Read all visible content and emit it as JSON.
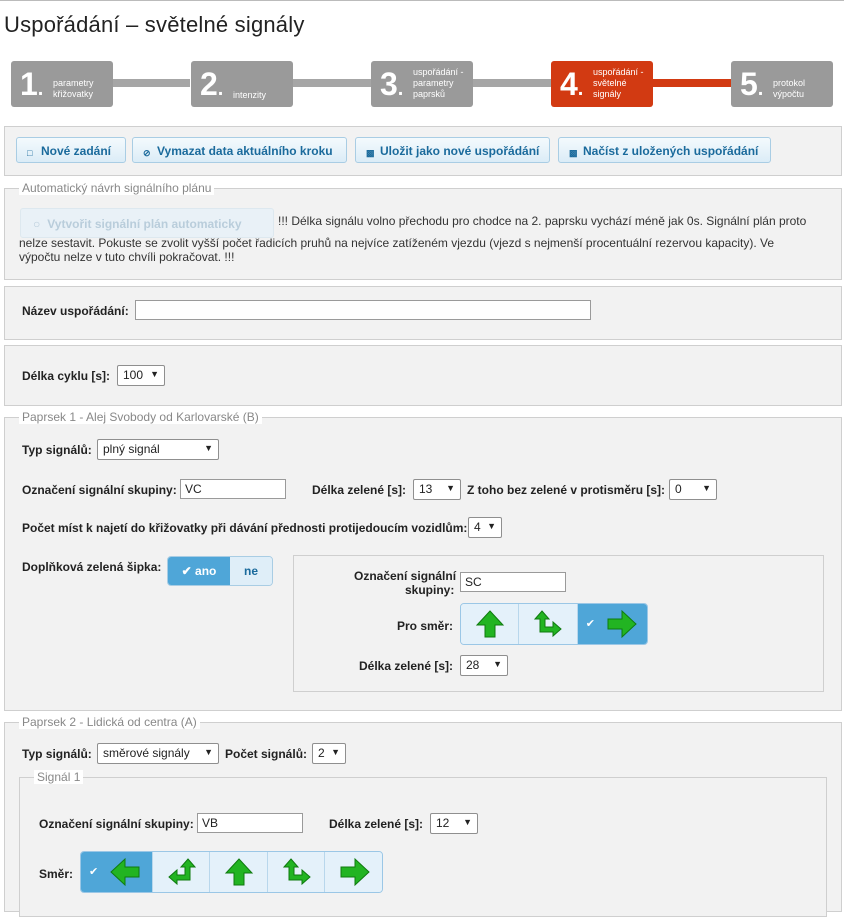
{
  "page_title": "Uspořádání – světelné signály",
  "wizard": {
    "steps": [
      {
        "num": "1",
        "label": "parametry křižovatky",
        "active": false
      },
      {
        "num": "2",
        "label": "intenzity",
        "active": false
      },
      {
        "num": "3",
        "label": "uspořádání - parametry paprsků",
        "active": false
      },
      {
        "num": "4",
        "label": "uspořádání - světelné signály",
        "active": true
      },
      {
        "num": "5",
        "label": "protokol výpočtu",
        "active": false
      }
    ]
  },
  "toolbar": {
    "new": "Nové zadání",
    "clear": "Vymazat data aktuálního kroku",
    "save": "Uložit jako nové uspořádání",
    "load": "Načíst z uložených uspořádání"
  },
  "auto": {
    "legend": "Automatický návrh signálního plánu",
    "button": "Vytvořit signální plán automaticky",
    "message_line1": "!!! Délka signálu volno přechodu pro chodce na 2. paprsku vychází méně jak 0s. Signální plán proto",
    "message_line2": "nelze sestavit. Pokuste se zvolit vyšší počet řadicích pruhů na nejvíce zatíženém vjezdu (vjezd s nejmenší procentuální rezervou kapacity). Ve",
    "message_line3": "výpočtu nelze v tuto chvíli pokračovat. !!!"
  },
  "name": {
    "label": "Název uspořádání:",
    "value": ""
  },
  "cycle": {
    "label": "Délka cyklu [s]:",
    "value": "100"
  },
  "arm1": {
    "legend": "Paprsek 1 - Alej Svobody od Karlovarské (B)",
    "type_label": "Typ signálů:",
    "type_value": "plný signál",
    "group_label": "Označení signální skupiny:",
    "group_value": "VC",
    "green_label": "Délka zelené [s]:",
    "green_value": "13",
    "nogreen_label": "Z toho bez zelené v protisměru [s]:",
    "nogreen_value": "0",
    "places_label": "Počet míst k najetí do křižovatky při dávání přednosti protijedoucím vozidlům:",
    "places_value": "4",
    "arrow_label": "Doplňková zelená šipka:",
    "arrow_yes": "ano",
    "arrow_no": "ne",
    "sub": {
      "group_label_1": "Označení signální",
      "group_label_2": "skupiny:",
      "group_value": "SC",
      "dir_label": "Pro směr:",
      "green_label": "Délka zelené [s]:",
      "green_value": "28"
    }
  },
  "arm2": {
    "legend": "Paprsek 2 - Lidická od centra (A)",
    "type_label": "Typ signálů:",
    "type_value": "směrové signály",
    "count_label": "Počet signálů:",
    "count_value": "2",
    "signal1": {
      "legend": "Signál 1",
      "group_label": "Označení signální skupiny:",
      "group_value": "VB",
      "green_label": "Délka zelené [s]:",
      "green_value": "12",
      "dir_label": "Směr:"
    }
  },
  "colors": {
    "accent_red": "#d23a12",
    "step_gray": "#9a9a9a",
    "button_blue": "#1a6a9c",
    "arrow_green": "#22b422"
  }
}
